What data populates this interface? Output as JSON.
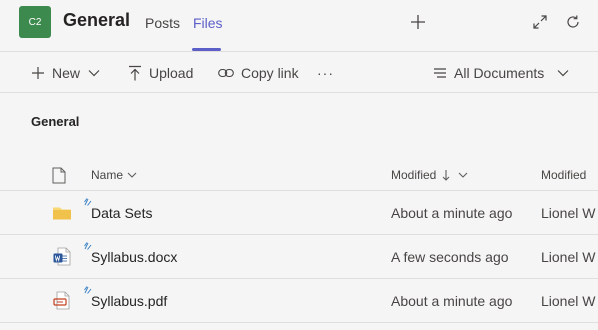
{
  "header": {
    "avatar_text": "C2",
    "avatar_color": "#3d8a4f",
    "team_name": "General",
    "tabs": [
      {
        "label": "Posts",
        "active": false
      },
      {
        "label": "Files",
        "active": true
      }
    ],
    "accent_color": "#5b5fc7",
    "icons": [
      "plus-icon",
      "expand-icon",
      "refresh-icon"
    ]
  },
  "toolbar": {
    "new_label": "New",
    "upload_label": "Upload",
    "copy_link_label": "Copy link",
    "more_label": "···",
    "view_label": "All Documents"
  },
  "content": {
    "section_title": "General",
    "columns": {
      "name": "Name",
      "modified": "Modified",
      "modified_by": "Modified"
    },
    "rows": [
      {
        "name": "Data Sets",
        "type": "folder-icon",
        "modified": "About a minute ago",
        "modified_by": "Lionel W"
      },
      {
        "name": "Syllabus.docx",
        "type": "word-icon",
        "modified": "A few seconds ago",
        "modified_by": "Lionel W"
      },
      {
        "name": "Syllabus.pdf",
        "type": "pdf-icon",
        "modified": "About a minute ago",
        "modified_by": "Lionel W"
      }
    ]
  }
}
